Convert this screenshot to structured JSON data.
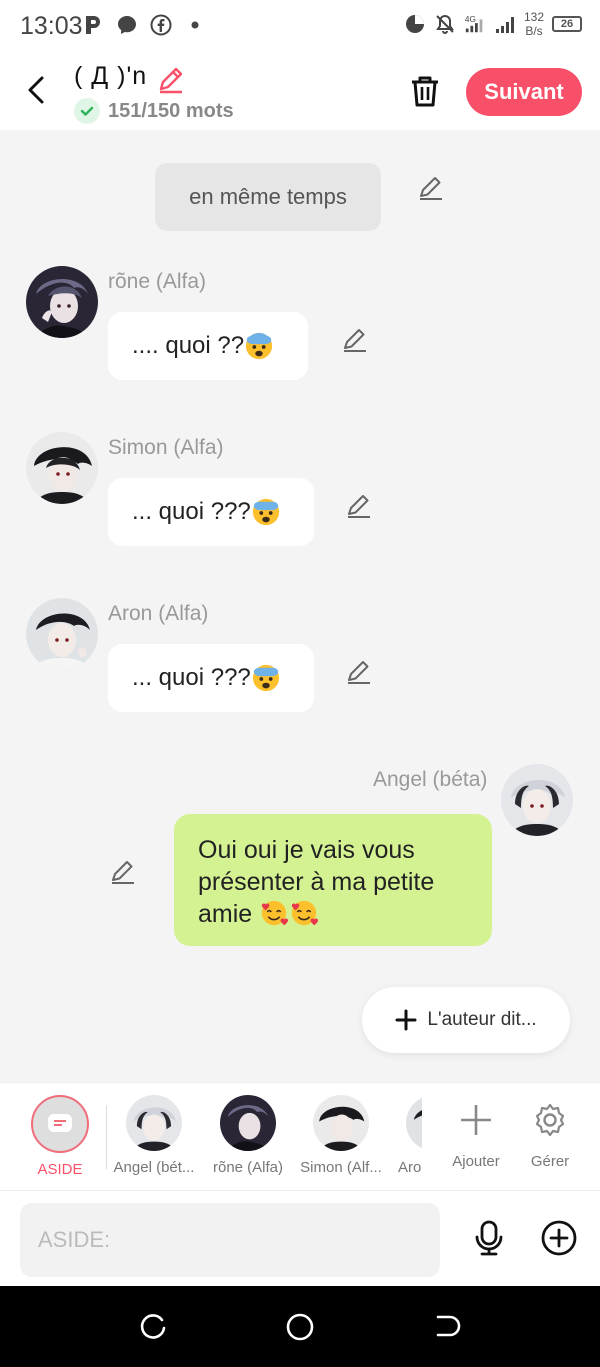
{
  "status_bar": {
    "time": "13:03",
    "speed_value": "132",
    "speed_unit": "B/s",
    "battery": "26",
    "signal_label": "4G"
  },
  "header": {
    "title": "( Д )'n",
    "word_count": "151/150 mots",
    "next_label": "Suivant",
    "accent_color": "#f9506a"
  },
  "messages": {
    "narration": "en même temps",
    "m1": {
      "name": "rõne (Alfa)",
      "text": ".... quoi ??"
    },
    "m2": {
      "name": "Simon (Alfa)",
      "text": "... quoi ???"
    },
    "m3": {
      "name": "Aron (Alfa)",
      "text": "... quoi ???"
    },
    "m4": {
      "name": "Angel (béta)",
      "line1": "Oui oui je vais vous",
      "line2": "présenter à ma petite",
      "line3": "amie "
    }
  },
  "author_button": {
    "label": "L'auteur dit..."
  },
  "characters": [
    {
      "label": "ASIDE"
    },
    {
      "label": "Angel (bét..."
    },
    {
      "label": "rõne (Alfa)"
    },
    {
      "label": "Simon (Alf..."
    },
    {
      "label": "Aro"
    },
    {
      "label": "Ajouter"
    },
    {
      "label": "Gérer"
    }
  ],
  "input": {
    "placeholder": "ASIDE:"
  }
}
